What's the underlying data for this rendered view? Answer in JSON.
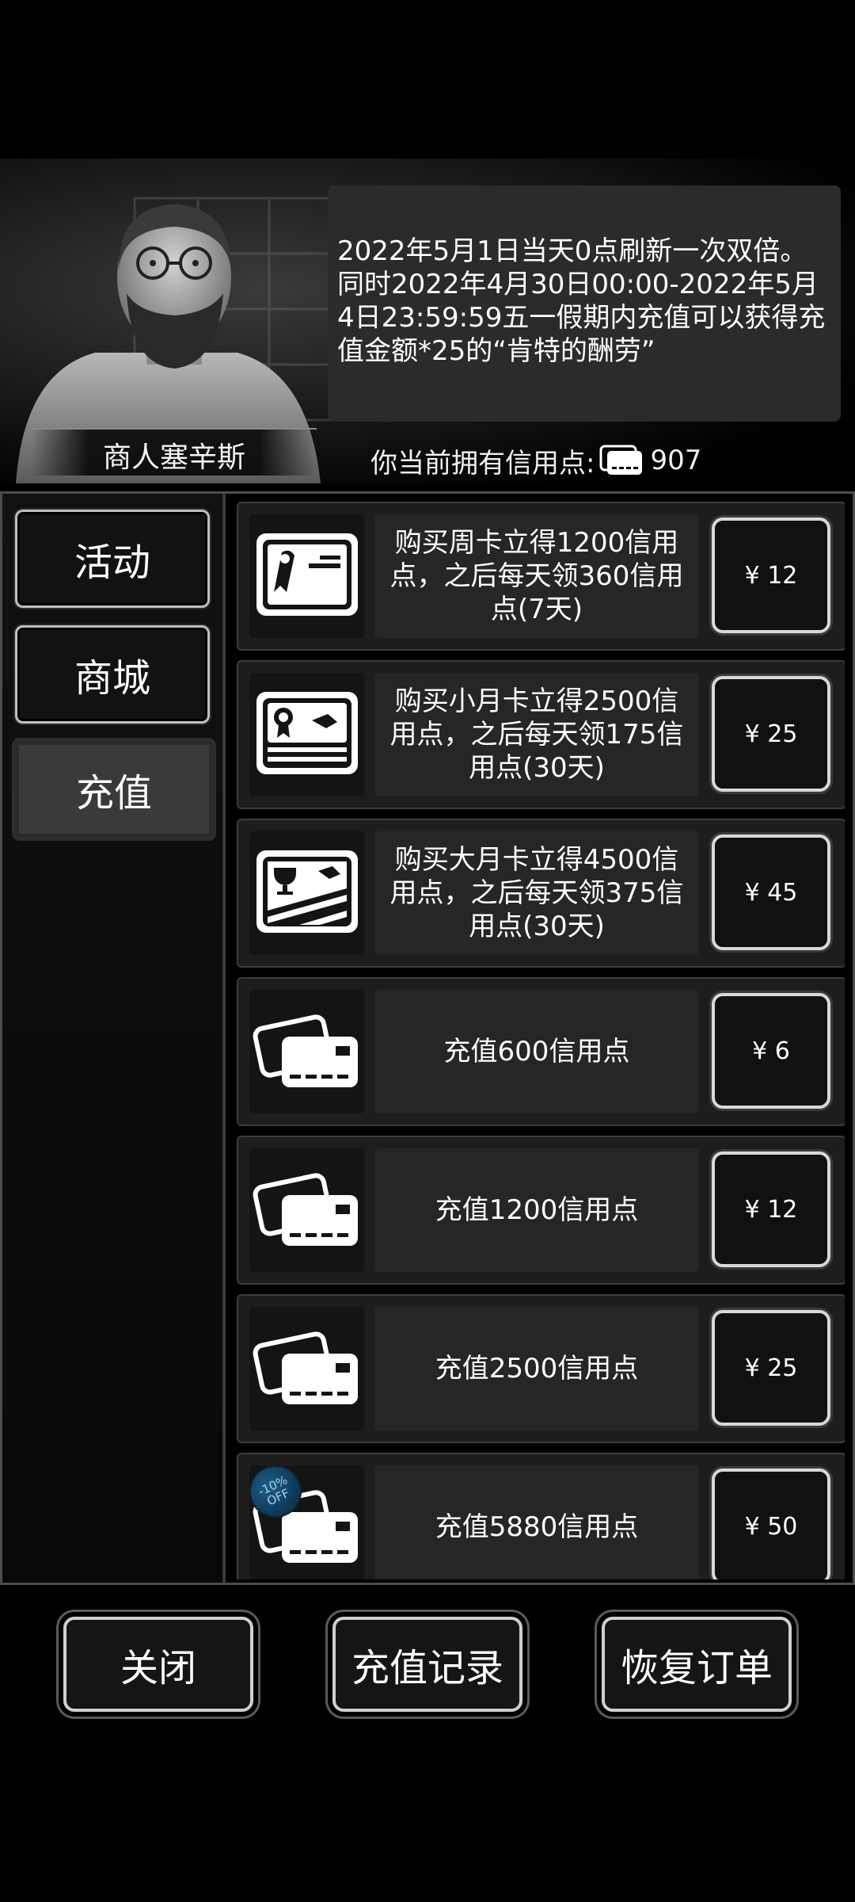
{
  "merchant": {
    "name": "商人塞辛斯",
    "message": "2022年5月1日当天0点刷新一次双倍。同时2022年4月30日00:00-2022年5月4日23:59:59五一假期内充值可以获得充值金额*25的“肯特的酬劳”"
  },
  "credits": {
    "label": "你当前拥有信用点:",
    "value": "907",
    "icon": "credit-card-icon"
  },
  "tabs": [
    {
      "label": "活动",
      "active": false
    },
    {
      "label": "商城",
      "active": false
    },
    {
      "label": "充值",
      "active": true
    }
  ],
  "items": [
    {
      "icon": "weekly-card-icon",
      "desc": "购买周卡立得1200信用点，之后每天领360信用点(7天)",
      "price": "¥ 12"
    },
    {
      "icon": "small-monthly-card-icon",
      "desc": "购买小月卡立得2500信用点，之后每天领175信用点(30天)",
      "price": "¥ 25"
    },
    {
      "icon": "large-monthly-card-icon",
      "desc": "购买大月卡立得4500信用点，之后每天领375信用点(30天)",
      "price": "¥ 45"
    },
    {
      "icon": "credit-cards-icon",
      "desc": "充值600信用点",
      "price": "¥ 6"
    },
    {
      "icon": "credit-cards-icon",
      "desc": "充值1200信用点",
      "price": "¥ 12"
    },
    {
      "icon": "credit-cards-icon",
      "desc": "充值2500信用点",
      "price": "¥ 25"
    },
    {
      "icon": "credit-cards-icon",
      "desc": "充值5880信用点",
      "price": "¥ 50",
      "badge": "-10% OFF"
    }
  ],
  "buttons": {
    "close": "关闭",
    "history": "充值记录",
    "restore": "恢复订单"
  },
  "colors": {
    "background": "#000000",
    "panel": "#1d1d1d",
    "button_border": "#d8d8d8",
    "discount_badge": "#1f5d86"
  }
}
